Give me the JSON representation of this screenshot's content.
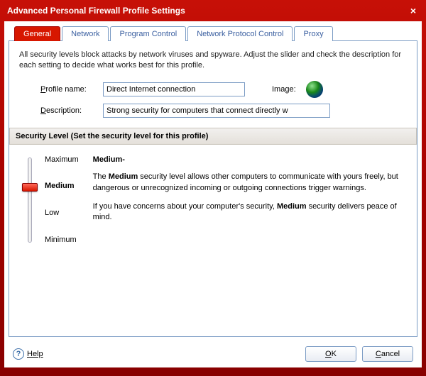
{
  "window": {
    "title": "Advanced Personal Firewall Profile Settings",
    "close_glyph": "×"
  },
  "tabs": [
    {
      "label": "General",
      "active": true
    },
    {
      "label": "Network",
      "active": false
    },
    {
      "label": "Program Control",
      "active": false
    },
    {
      "label": "Network Protocol Control",
      "active": false
    },
    {
      "label": "Proxy",
      "active": false
    }
  ],
  "intro": "All security levels block attacks by network viruses and spyware. Adjust the slider and check the description for each setting to decide what works best for this profile.",
  "form": {
    "profile_label": "Profile name:",
    "profile_value": "Direct Internet connection",
    "image_label": "Image:",
    "globe_icon_name": "globe-icon",
    "description_label": "Description:",
    "description_value": "Strong security for computers that connect directly w"
  },
  "section_header": "Security Level (Set the security level for this profile)",
  "slider": {
    "levels": [
      "Maximum",
      "Medium",
      "Low",
      "Minimum"
    ],
    "selected": "Medium"
  },
  "level_description": {
    "title": "Medium-",
    "para1_pre": "The ",
    "para1_bold": "Medium",
    "para1_post": " security level allows other computers to communicate with yours freely, but dangerous or unrecognized incoming or outgoing connections trigger warnings.",
    "para2_pre": "If you have concerns about your computer's security, ",
    "para2_bold": "Medium",
    "para2_post": " security delivers peace of mind."
  },
  "buttons": {
    "help": "Help",
    "help_glyph": "?",
    "ok": "OK",
    "cancel": "Cancel"
  },
  "colors": {
    "brand_red": "#c71007",
    "border_blue": "#7a9bc4"
  }
}
